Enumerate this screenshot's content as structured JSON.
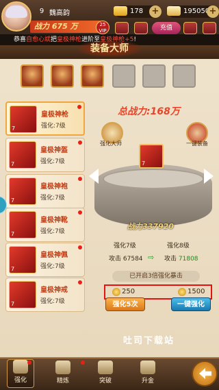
{
  "player": {
    "level": "9",
    "name": "魏高韵",
    "power": "战力 675 万",
    "vip": "25\nVIP"
  },
  "resources": {
    "gold": "178",
    "silver": "195050"
  },
  "top": {
    "charge": "充值"
  },
  "marquee": {
    "prefix": "恭喜",
    "a": "自愈心斌",
    "mid": "把",
    "b": "皇极神枪",
    "mid2": "进阶至",
    "c": "皇极神枪+5",
    "suffix": "!"
  },
  "title": "装备大师",
  "list": [
    {
      "name": "皇极神枪",
      "stat": "强化:7级",
      "lvl": "7"
    },
    {
      "name": "皇极神盔",
      "stat": "强化:7级",
      "lvl": "7"
    },
    {
      "name": "皇极神袍",
      "stat": "强化:7级",
      "lvl": "7"
    },
    {
      "name": "皇极神靴",
      "stat": "强化:7级",
      "lvl": "7"
    },
    {
      "name": "皇极神佩",
      "stat": "强化:7级",
      "lvl": "7"
    },
    {
      "name": "皇极神戒",
      "stat": "强化:7级",
      "lvl": "7"
    }
  ],
  "total_power": "总战力:168万",
  "side": {
    "left": "强化大师",
    "right": "一键装备"
  },
  "equip_level": "7",
  "equip_power": "战力337920",
  "stats": {
    "cur_level": "强化7级",
    "next_level": "强化8级",
    "cur_attack_label": "攻击",
    "cur_attack": "67584",
    "next_attack_label": "攻击",
    "next_attack": "71808",
    "arrow": "⇨"
  },
  "boost": "已开启3倍强化暴击",
  "costs": {
    "single": "250",
    "all": "1500"
  },
  "buttons": {
    "enhance5": "强化5次",
    "one_key": "一键强化"
  },
  "watermark": "吐司下载站",
  "nav": [
    {
      "label": "强化"
    },
    {
      "label": "精炼"
    },
    {
      "label": "突破"
    },
    {
      "label": "升金"
    }
  ]
}
